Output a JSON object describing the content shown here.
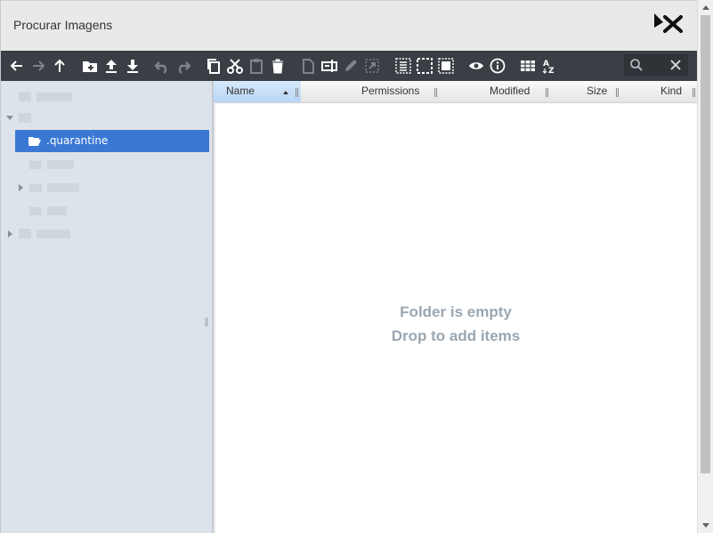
{
  "dialog": {
    "title": "Procurar Imagens"
  },
  "toolbar": {
    "buttons": [
      {
        "name": "back-icon"
      },
      {
        "name": "forward-icon"
      },
      {
        "name": "up-icon"
      },
      {
        "name": "new-folder-icon"
      },
      {
        "name": "upload-icon"
      },
      {
        "name": "download-icon"
      },
      {
        "name": "undo-icon"
      },
      {
        "name": "redo-icon"
      },
      {
        "name": "copy-icon"
      },
      {
        "name": "cut-icon"
      },
      {
        "name": "paste-icon"
      },
      {
        "name": "delete-icon"
      },
      {
        "name": "duplicate-icon"
      },
      {
        "name": "rename-icon"
      },
      {
        "name": "edit-icon"
      },
      {
        "name": "resize-icon"
      },
      {
        "name": "select-all-icon"
      },
      {
        "name": "select-none-icon"
      },
      {
        "name": "invert-selection-icon"
      },
      {
        "name": "preview-icon"
      },
      {
        "name": "info-icon"
      },
      {
        "name": "view-list-icon"
      },
      {
        "name": "sort-icon"
      }
    ],
    "search": {
      "value": "",
      "placeholder": ""
    }
  },
  "tree": {
    "selected": ".quarantine"
  },
  "columns": [
    "Name",
    "Permissions",
    "Modified",
    "Size",
    "Kind"
  ],
  "sort": {
    "column": "Name",
    "direction": "ascending"
  },
  "empty": {
    "line1": "Folder is empty",
    "line2": "Drop to add items"
  },
  "colors": {
    "toolbar_bg": "#3a3f45",
    "selected_bg": "#3a78d4",
    "sidebar_bg": "#dde3ea",
    "empty_text": "#9ba6b0"
  }
}
